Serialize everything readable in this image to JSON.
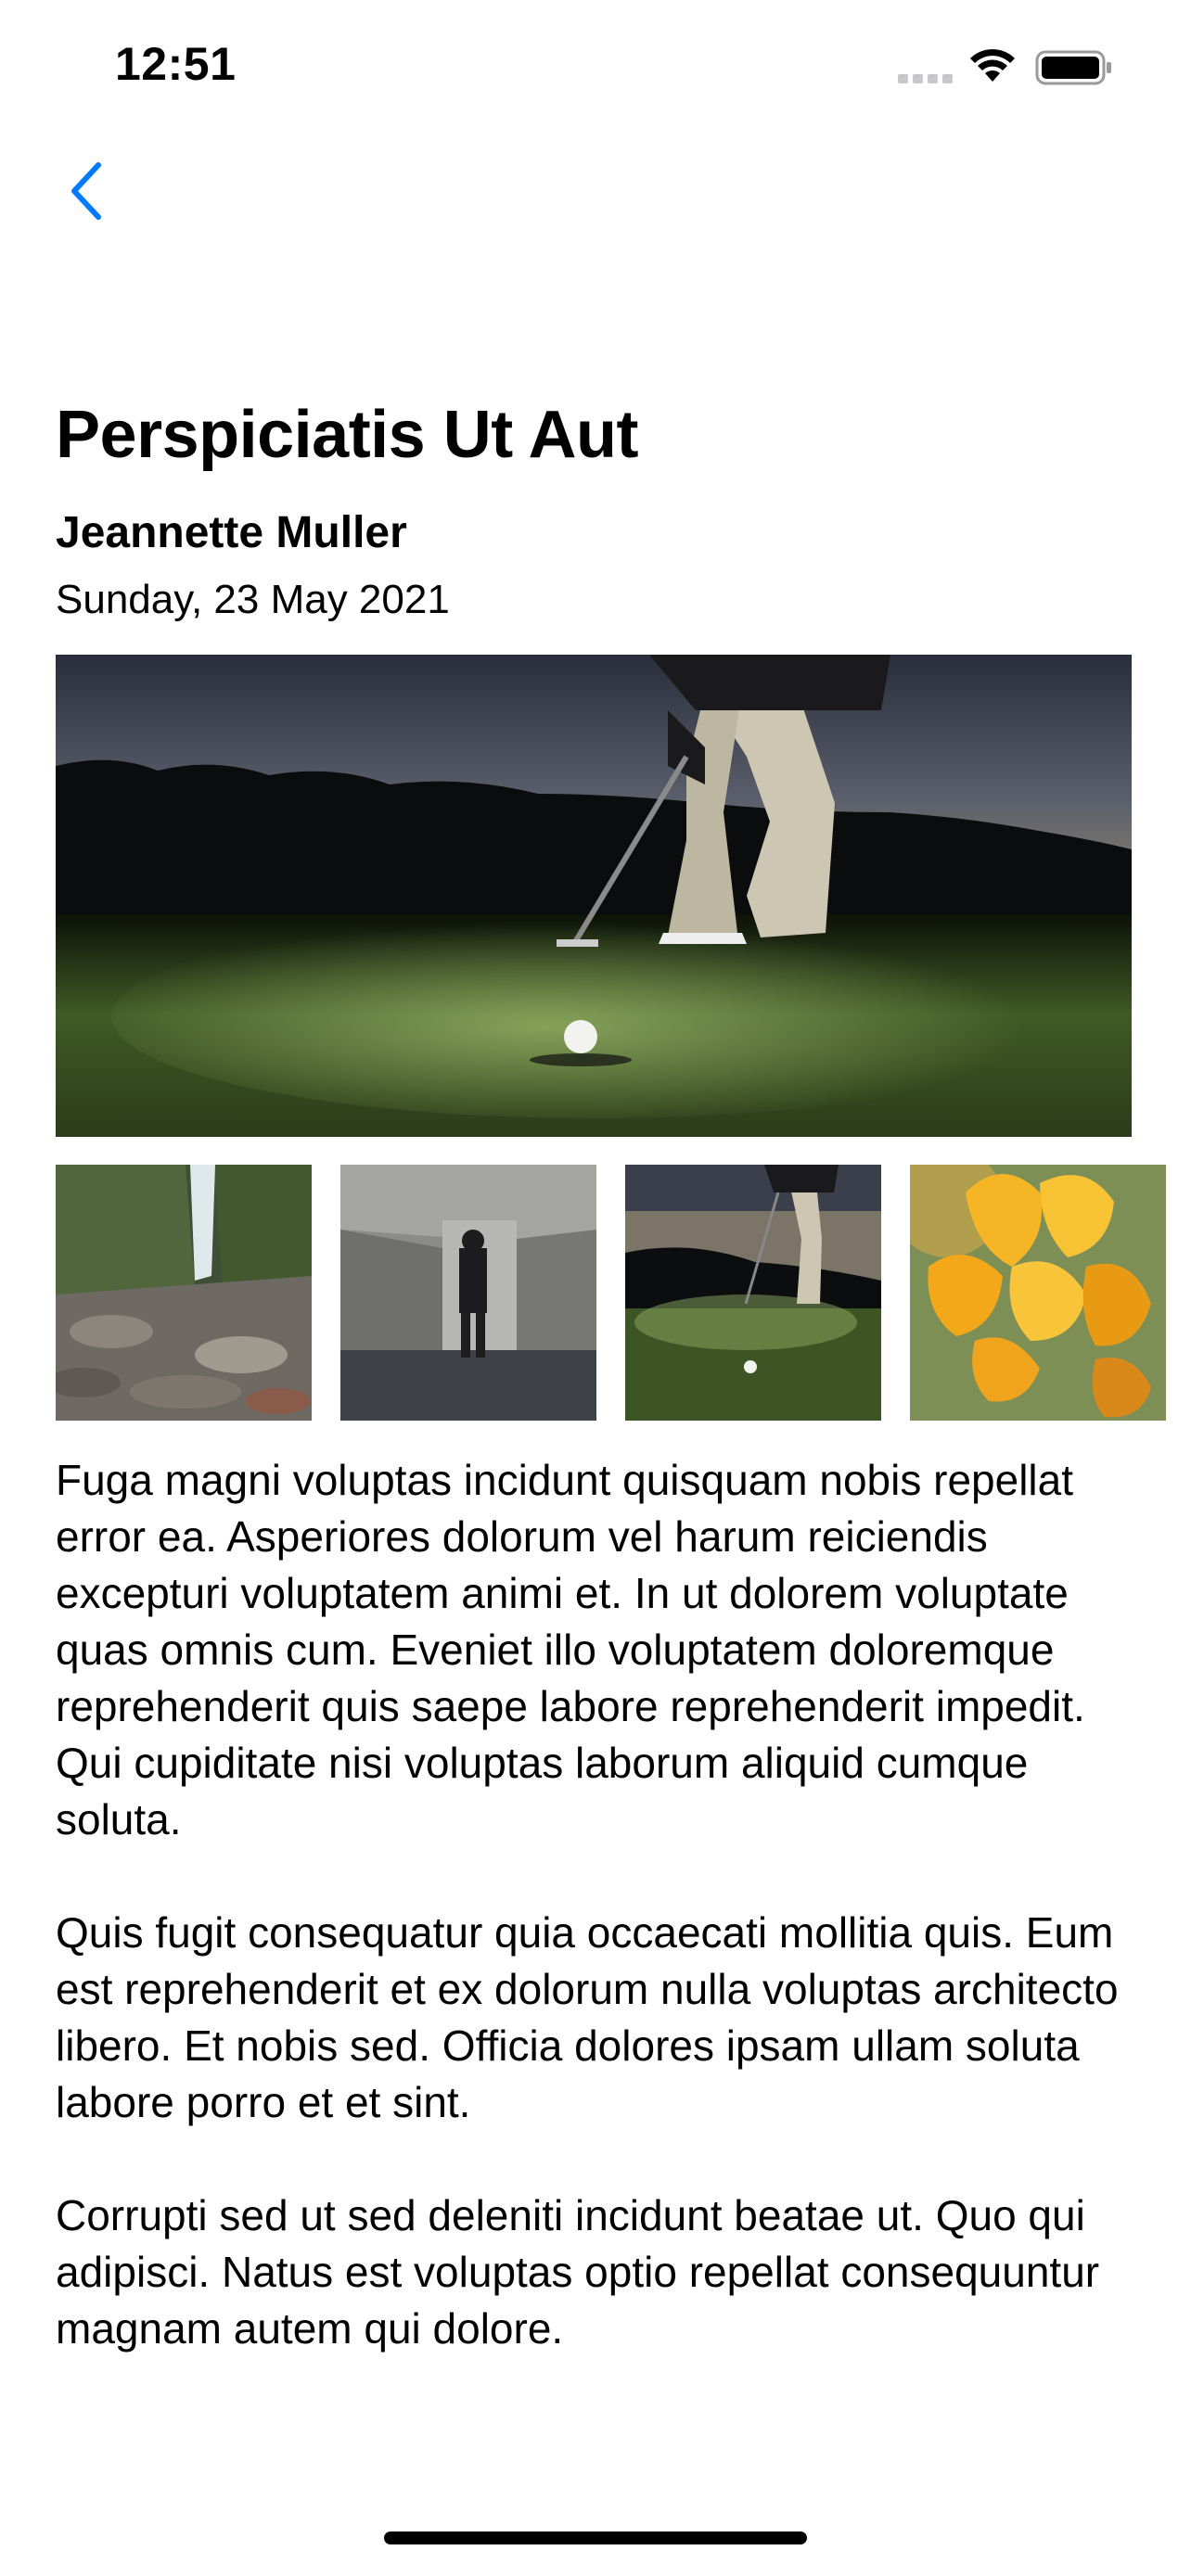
{
  "status_bar": {
    "time": "12:51",
    "signal_icon": "cellular-signal-icon",
    "wifi_icon": "wifi-icon",
    "battery_icon": "battery-icon"
  },
  "nav": {
    "back_icon": "chevron-left-icon",
    "accent_color": "#007AFF"
  },
  "article": {
    "title": "Perspiciatis Ut Aut",
    "author": "Jeannette Muller",
    "date": "Sunday, 23 May 2021",
    "hero_image": "golfer-putting-at-dusk-image",
    "thumbnails": [
      "waterfall-rocks-image",
      "person-in-concrete-corridor-image",
      "golfer-putting-at-dusk-image",
      "yellow-flowers-image"
    ],
    "paragraphs": [
      "Fuga magni voluptas incidunt quisquam nobis repellat error ea. Asperiores dolorum vel harum reiciendis excepturi voluptatem animi et. In ut dolorem voluptate quas omnis cum. Eveniet illo voluptatem doloremque reprehenderit quis saepe labore reprehenderit impedit. Qui cupiditate nisi voluptas laborum aliquid cumque soluta.",
      "Quis fugit consequatur quia occaecati mollitia quis. Eum est reprehenderit et ex dolorum nulla voluptas architecto libero. Et nobis sed. Officia dolores ipsam ullam soluta labore porro et et sint.",
      "Corrupti sed ut sed deleniti incidunt beatae ut. Quo qui adipisci. Natus est voluptas optio repellat consequuntur magnam autem qui dolore."
    ]
  }
}
